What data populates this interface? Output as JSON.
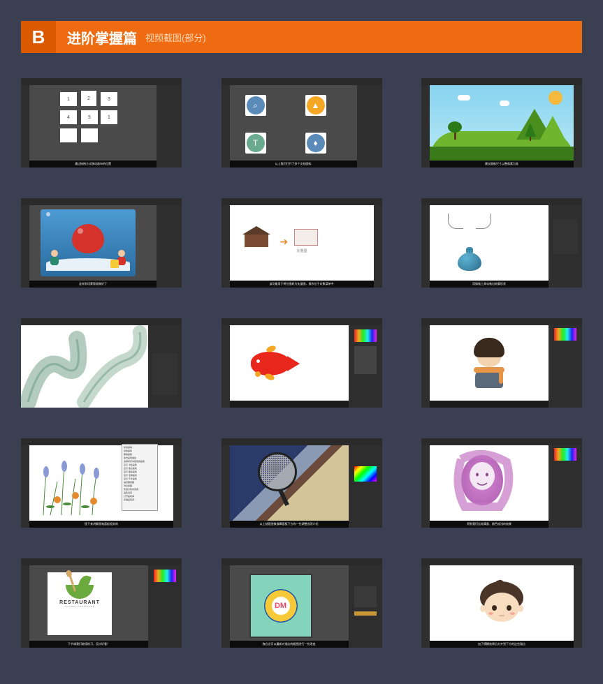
{
  "header": {
    "badge": "B",
    "title": "进阶掌握篇",
    "subtitle": "视频截图(部分)"
  },
  "thumbs": [
    {
      "caption": "通过拖拽方式移动画布的位置",
      "artboards": [
        "1",
        "2",
        "3",
        "4",
        "5",
        "1"
      ]
    },
    {
      "caption": "以上我们打开了多个文档图标"
    },
    {
      "caption": "建议画板尺寸以整像素为准"
    },
    {
      "caption": "这样剪切蒙版就做好了"
    },
    {
      "caption": "该功能用于将位图转为矢量图，操作位于对象菜单中",
      "label_vector": "矢量图"
    },
    {
      "caption": "用钢笔工具勾勒出轮廓形状"
    },
    {
      "caption": ""
    },
    {
      "caption": ""
    },
    {
      "caption": ""
    },
    {
      "caption": "接下来讲解画笔面板相关的",
      "menu_items": [
        "新建画笔...",
        "复制画笔",
        "删除画笔",
        "移去画笔描边",
        "选择所有未使用的画笔",
        "显示 书法画笔",
        "显示 散点画笔",
        "显示 图案画笔",
        "显示 毛刷画笔",
        "显示 艺术画笔",
        "缩览图视图",
        "列表视图",
        "所选对象的选项...",
        "画笔选项...",
        "打开画笔库",
        "存储画笔库..."
      ]
    },
    {
      "caption": "以上就是图像描摹面板下方的一些调整选项介绍"
    },
    {
      "caption": "得到我们比较满意、颜色较浅的效果"
    },
    {
      "caption": "下节课我们继续练习，设计好看！",
      "logo_text": "RESTAURANT",
      "logo_sub": "YOURSLOGANHERE"
    },
    {
      "caption": "拖右边可以重新对描边的粗细进行一些改变",
      "badge_text": "DM"
    },
    {
      "caption": "加了模糊效果后对齐到下方的这些锚点"
    }
  ]
}
